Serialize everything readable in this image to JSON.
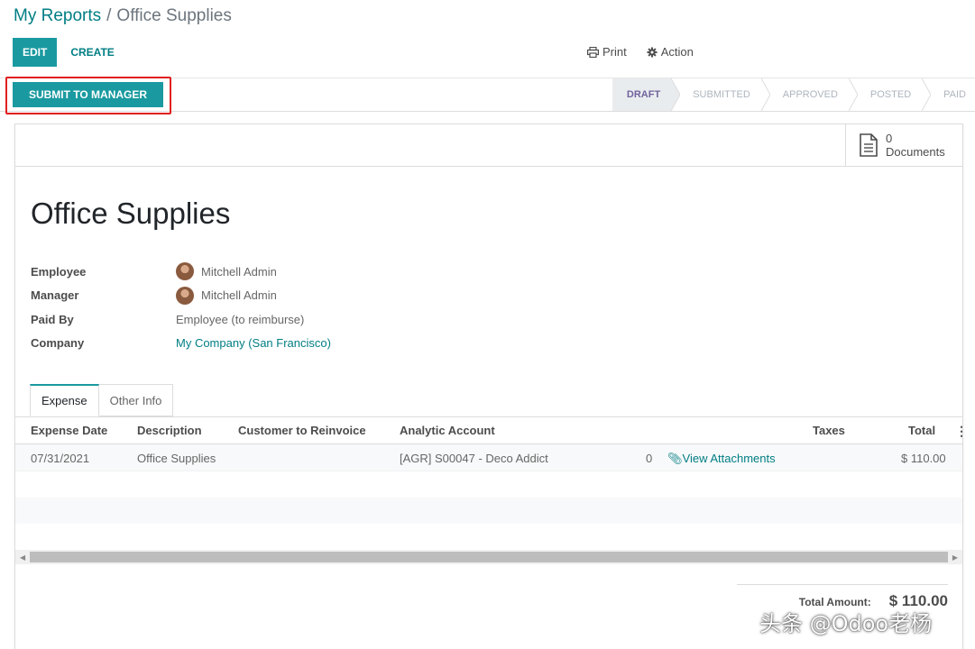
{
  "breadcrumb": {
    "parent": "My Reports",
    "separator": "/",
    "current": "Office Supplies"
  },
  "toolbar": {
    "edit_label": "EDIT",
    "create_label": "CREATE",
    "print_label": "Print",
    "action_label": "Action"
  },
  "statusbar": {
    "submit_label": "SUBMIT TO MANAGER",
    "stages": [
      {
        "label": "DRAFT",
        "active": true
      },
      {
        "label": "SUBMITTED",
        "active": false
      },
      {
        "label": "APPROVED",
        "active": false
      },
      {
        "label": "POSTED",
        "active": false
      },
      {
        "label": "PAID",
        "active": false
      }
    ]
  },
  "documents": {
    "count": "0",
    "label": "Documents"
  },
  "form": {
    "title": "Office Supplies",
    "fields": [
      {
        "label": "Employee",
        "value": "Mitchell Admin"
      },
      {
        "label": "Manager",
        "value": "Mitchell Admin"
      },
      {
        "label": "Paid By",
        "value": "Employee (to reimburse)"
      },
      {
        "label": "Company",
        "value": "My Company (San Francisco)"
      }
    ]
  },
  "tabs": [
    {
      "label": "Expense",
      "active": true
    },
    {
      "label": "Other Info",
      "active": false
    }
  ],
  "table": {
    "headers": {
      "date": "Expense Date",
      "description": "Description",
      "customer": "Customer to Reinvoice",
      "analytic": "Analytic Account",
      "taxes": "Taxes",
      "total": "Total"
    },
    "rows": [
      {
        "date": "07/31/2021",
        "description": "Office Supplies",
        "analytic": "[AGR] S00047 - Deco Addict",
        "attachments_count": "0",
        "attachments_label": "View Attachments",
        "total": "$ 110.00"
      }
    ]
  },
  "totals": {
    "label": "Total Amount:",
    "value": "$ 110.00"
  },
  "watermark": "头条 @Odoo老杨",
  "colors": {
    "primary": "#1a9aa0",
    "link": "#017e84",
    "active_stage": "#71639e",
    "highlight_box": "#e0201e"
  }
}
